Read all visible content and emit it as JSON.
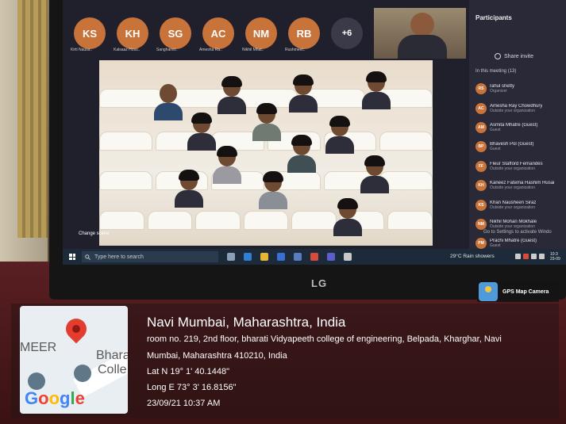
{
  "meeting": {
    "avatars": [
      "KS",
      "KH",
      "SG",
      "AC",
      "NM",
      "RB",
      "+6"
    ],
    "avatar_names": [
      "Kirti Nausa..",
      "Kalsaaz Hoss..",
      "Sanghamit..",
      "Amesha Ra..",
      "Nikhil Mhat..",
      "Rushmeet.."
    ],
    "change_scene": "Change scene",
    "panel_title": "Participants",
    "share_invite": "Share invite",
    "in_meeting": "In this meeting (13)",
    "participants": [
      {
        "initials": "RS",
        "name": "rahul shetty",
        "role": "Organizer"
      },
      {
        "initials": "AC",
        "name": "Amesha Ray Chowdhury",
        "role": "Outside your organization"
      },
      {
        "initials": "AM",
        "name": "Asmita Mhatre (Guest)",
        "role": "Guest"
      },
      {
        "initials": "BP",
        "name": "Bhavesh Pol (Guest)",
        "role": "Guest"
      },
      {
        "initials": "FF",
        "name": "Fleur Stafford Fernandes",
        "role": "Outside your organization"
      },
      {
        "initials": "KH",
        "name": "Kaneez Fatema Hashim Husai",
        "role": "Outside your organization"
      },
      {
        "initials": "KS",
        "name": "Khan Nausheen Siraz",
        "role": "Outside your organization"
      },
      {
        "initials": "NM",
        "name": "Nikhil Mohan Mokhale",
        "role": "Outside your organization"
      },
      {
        "initials": "PM",
        "name": "Prachi Mhatre (Guest)",
        "role": "Guest"
      }
    ],
    "activate_windows": "Go to Settings to activate Windo"
  },
  "taskbar": {
    "search_placeholder": "Type here to search",
    "weather": "29°C  Rain showers",
    "clock": [
      "10:3",
      "23-09"
    ]
  },
  "monitor_brand": "LG",
  "gps_camera": {
    "label": "GPS Map Camera",
    "map_labels": [
      "MEER",
      "Bhara",
      "Colle"
    ],
    "google": "Google",
    "location_title": "Navi Mumbai, Maharashtra, India",
    "address_line1": "room no. 219, 2nd floor, bharati Vidyapeeth college of engineering, Belpada, Kharghar, Navi",
    "address_line2": "Mumbai, Maharashtra 410210, India",
    "lat": "Lat N 19° 1' 40.1448\"",
    "long": "Long E 73° 3' 16.8156\"",
    "datetime": "23/09/21 10:37 AM"
  },
  "colors": {
    "avatar_orange": "#c8733a",
    "panel_dark": "#292937",
    "pin_red": "#e43d2f"
  }
}
